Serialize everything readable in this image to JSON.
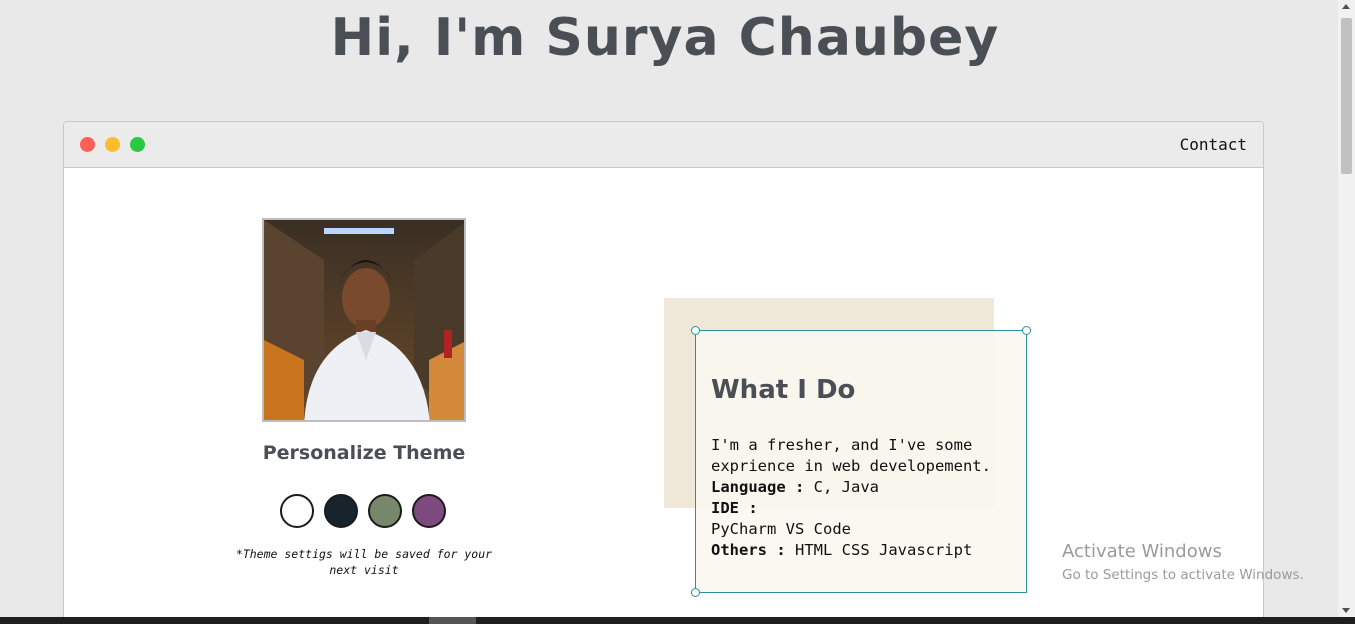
{
  "page": {
    "title": "Hi, I'm Surya Chaubey"
  },
  "window": {
    "nav_contact": "Contact"
  },
  "profile": {
    "photo_icon": "person-portrait",
    "theme_heading": "Personalize Theme",
    "theme_swatches": [
      {
        "name": "light",
        "color": "#ffffff"
      },
      {
        "name": "dark-blue",
        "color": "#17242e"
      },
      {
        "name": "green",
        "color": "#78866b"
      },
      {
        "name": "purple",
        "color": "#7c4a7f"
      }
    ],
    "theme_note": "*Theme settigs will be saved for your next visit"
  },
  "what_i_do": {
    "heading": "What I Do",
    "intro": "I'm a fresher, and I've some exprience in web developement.",
    "language_label": "Language :",
    "language_value": "C, Java",
    "ide_label": "IDE :",
    "ide_value": "PyCharm VS Code",
    "others_label": "Others :",
    "others_value": "HTML CSS Javascript"
  },
  "watermark": {
    "line1": "Activate Windows",
    "line2": "Go to Settings to activate Windows."
  },
  "colors": {
    "accent": "#2a8f9e",
    "title_text": "#4a4e55",
    "page_bg": "#e9e9e9"
  }
}
